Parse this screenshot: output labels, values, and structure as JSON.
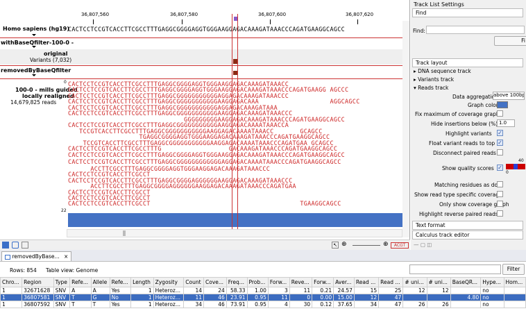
{
  "ruler": {
    "ticks": [
      "36,807,560",
      "36,807,580",
      "36,807,600",
      "36,807,620"
    ]
  },
  "tracks": {
    "ref_label": "Homo sapiens (hg19)",
    "ref_seq": "CACTCCTCCGTCACCTTCGCCTTTGAGGCGGGGAGGTGGGAAGGAGACAAAGATAAACCCAGATGAAGGCAGCC",
    "filter_label": "withBaseQfilter-100-0 -",
    "variants_title": "original",
    "variants_count": "Variants (7,032)",
    "removed_label": "removedByBaseQfilter",
    "reads_title": "100-0 - mills guided",
    "reads_sub": "locally realigned",
    "reads_count": "14,679,825 reads",
    "zero_label": "0",
    "cov_label": "22"
  },
  "reads": [
    "CACTCCTCCGTCACCTTCGCCTTTGAGGCGGGGAGGTGGGAAGGAGACAAAGATAAACC",
    "CACTCCTCCGTCACCTTCGCCTTTGAGGCGGGGAGGTGGGAAGGAGACAAAGATAAACCCAGATGAAGG AGCCC",
    "CACTCCTCCGTCACCTTCGCCTTTGAGGCGGGGGGGGGGGAGGAGACAAAGATAAACCC",
    "CACTCCTCCGTCACCTTCGCCTTTGAGGCGGGGGGGGGGGAAGGAGACAAA                   AGGCAGCC",
    "CACTCCTCCGTCACCTTCGCCTTTGAGGCGGGGGGGGGGGAGGAGACAAAGATAAA",
    "CACTCCTCCGTCACCTTCGCCTTTGAGGCGGGGGGGGGGGAAGGAGACAAAGATAAACCC",
    "                               GGGGGGGGGAAGGAGACAAAGATAAACCCAGATGAAGGCAGCC",
    "CACTCCTCCGTCACCTTCGCCTTTGAGGCGGGGGGGGGGGAAGGAGACAAAATAAACCA",
    "   TCCGTCACCTTCGCCTTTGAGGCGGGGGGGGGGGAAGGAGACAAAATAAACC       GCAGCC",
    "                   TGAGGCGGGGAGGTGGGAAGGAGACAAAGATAAACCCAGATGAAGGCAGCC",
    "    TCCGTCACCTTCGCCTTTGAGGCGGGGGGGGGGGAAGGAGACAAAATAAACCCAGATGAA GCAGCC",
    "CACTCCTCCGTCACCTTCGCCTTTG                  GACAAAGATAAACCCAGATGAAGGCAGCC",
    "CACTCCTCCGTCACCTTCGCCTTTGAGGCGGGGAGGTGGGAAGGAGACAAAGATAAACCCAGATGAAGGCAGCC",
    "CACTCCTCCGTCACCTTCGCCTTTGAGGCGGGGGGGGGGGGAGGAGACAAAATAAACCCAGATGAAGGCAGCC",
    "      ACCTTCGCCTTTGAGGCGGGGAGGTGGGAAGGAGACAAAGATAAACCC",
    "CACTCCTCCGTCACCTTCGCCT",
    "CACTCCTCCGTCACCTTCGCCTTTGAGGCGGGGAGGGGGGAAGGAGACAAAGATAAACCC",
    "      ACCTTCGCCTTTGAGGCGGGGAGGGGGGAAGGAGACAAAGATAAACCCAGATGAA",
    "CACTCCTCCGTCACCTTCGCCT",
    "CACTCCTCCGTCACCTTCGCCT",
    "CACTCCTCCGTCACCTTCGCCT                                        TGAAGGCAGCC"
  ],
  "side": {
    "title": "Track List Settings",
    "find_tab": "Find",
    "find_label": "Find:",
    "find_btn": "Fi",
    "layout_tab": "Track layout",
    "dna": "DNA sequence track",
    "variants": "Variants track",
    "reads": "Reads track",
    "agg_label": "Data aggregation",
    "agg_value": "above 100bp",
    "graph_color": "Graph color",
    "fixmax": "Fix maximum of coverage graph",
    "hide_ins": "Hide insertions below (%)",
    "hide_ins_val": "1.0",
    "highlight": "Highlight variants",
    "float": "Float variant reads to top",
    "disconnect": "Disconnect paired reads",
    "quality": "Show quality scores",
    "quality_lo": "0",
    "quality_hi": "40",
    "matching": "Matching residues as dots",
    "readtype": "Show read type specific coverage",
    "onlycov": "Only show coverage graph",
    "revpair": "Highlight reverse paired reads",
    "text_format": "Text format",
    "calc": "Calculus track editor"
  },
  "tab": {
    "title": "removedByBase...",
    "close": "×"
  },
  "table": {
    "rows_label": "Rows: 854",
    "view_label": "Table view: Genome",
    "filter_btn": "Filter",
    "headers": [
      "Chro...",
      "Region",
      "Type",
      "Refe...",
      "Allele",
      "Refe...",
      "Length",
      "Zygosity",
      "Count",
      "Cove...",
      "Freq...",
      "Prob...",
      "Forw...",
      "Reve...",
      "Forw...",
      "Aver...",
      "Read ...",
      "Read ...",
      "# uni...",
      "# uni...",
      "BaseQR...",
      "Hype...",
      "Hom..."
    ],
    "rows": [
      [
        "1",
        "32671628",
        "SNV",
        "A",
        "A",
        "Yes",
        "1",
        "Heteroz...",
        "14",
        "24",
        "58.33",
        "1.00",
        "3",
        "11",
        "0.21",
        "24.57",
        "15",
        "25",
        "12",
        "12",
        "",
        "no",
        ""
      ],
      [
        "1",
        "36807581",
        "SNV",
        "T",
        "G",
        "No",
        "1",
        "Heteroz...",
        "11",
        "46",
        "23.91",
        "0.95",
        "11",
        "0",
        "0.00",
        "15.00",
        "12",
        "47",
        "",
        "",
        "4.80",
        "no",
        ""
      ],
      [
        "1",
        "36807592",
        "SNV",
        "T",
        "T",
        "Yes",
        "1",
        "Heteroz...",
        "34",
        "46",
        "73.91",
        "0.95",
        "4",
        "30",
        "0.12",
        "37.65",
        "34",
        "47",
        "26",
        "26",
        "",
        "no",
        ""
      ]
    ]
  }
}
